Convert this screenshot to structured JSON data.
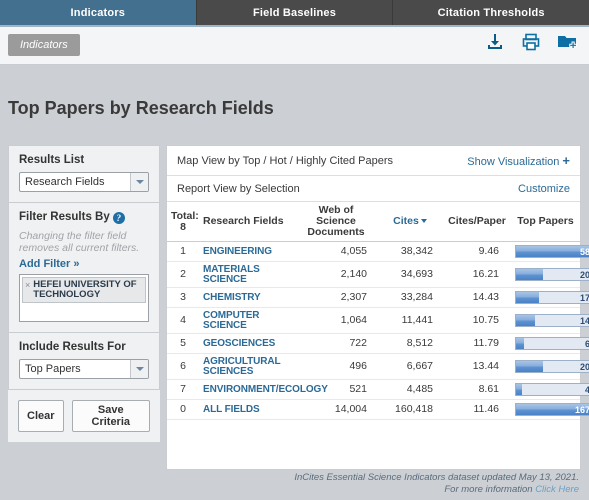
{
  "tabs": [
    {
      "label": "Indicators",
      "active": true
    },
    {
      "label": "Field Baselines",
      "active": false
    },
    {
      "label": "Citation Thresholds",
      "active": false
    }
  ],
  "toolbar": {
    "breadcrumb": "Indicators",
    "icons": [
      {
        "name": "download-icon",
        "label": "Download"
      },
      {
        "name": "print-icon",
        "label": "Print"
      },
      {
        "name": "add-to-folder-icon",
        "label": "Add to folder"
      }
    ]
  },
  "page_title": "Top Papers by Research Fields",
  "sidebar": {
    "results_list": {
      "label": "Results List",
      "value": "Research Fields"
    },
    "filter": {
      "label": "Filter Results By",
      "help_icon": "help-icon",
      "hint": "Changing the filter field removes all current filters.",
      "add_filter": "Add Filter »",
      "chips": [
        {
          "remove": "×",
          "label": "HEFEI UNIVERSITY OF TECHNOLOGY"
        }
      ]
    },
    "include": {
      "label": "Include Results For",
      "value": "Top Papers"
    },
    "buttons": {
      "clear": "Clear",
      "save": "Save Criteria"
    }
  },
  "main": {
    "map_view_label": "Map View by Top / Hot / Highly Cited Papers",
    "show_visualization": "Show Visualization",
    "report_view_label": "Report View by Selection",
    "customize": "Customize",
    "total_label": "Total:",
    "total_value": "8"
  },
  "chart_data": {
    "type": "table",
    "title": "Top Papers by Research Fields",
    "columns": [
      "Total:\n8",
      "Research Fields",
      "Web of Science Documents",
      "Cites",
      "Cites/Paper",
      "Top Papers"
    ],
    "sorted_by": "Cites",
    "sort_direction": "desc",
    "rows": [
      {
        "rank": "1",
        "field": "ENGINEERING",
        "wos": "4,055",
        "cites": "38,342",
        "cites_per_paper": "9.46",
        "top_papers": "58",
        "bar_pct": 100
      },
      {
        "rank": "2",
        "field": "MATERIALS SCIENCE",
        "wos": "2,140",
        "cites": "34,693",
        "cites_per_paper": "16.21",
        "top_papers": "20",
        "bar_pct": 35
      },
      {
        "rank": "3",
        "field": "CHEMISTRY",
        "wos": "2,307",
        "cites": "33,284",
        "cites_per_paper": "14.43",
        "top_papers": "17",
        "bar_pct": 30
      },
      {
        "rank": "4",
        "field": "COMPUTER SCIENCE",
        "wos": "1,064",
        "cites": "11,441",
        "cites_per_paper": "10.75",
        "top_papers": "14",
        "bar_pct": 25
      },
      {
        "rank": "5",
        "field": "GEOSCIENCES",
        "wos": "722",
        "cites": "8,512",
        "cites_per_paper": "11.79",
        "top_papers": "6",
        "bar_pct": 11
      },
      {
        "rank": "6",
        "field": "AGRICULTURAL SCIENCES",
        "wos": "496",
        "cites": "6,667",
        "cites_per_paper": "13.44",
        "top_papers": "20",
        "bar_pct": 35
      },
      {
        "rank": "7",
        "field": "ENVIRONMENT/ECOLOGY",
        "wos": "521",
        "cites": "4,485",
        "cites_per_paper": "8.61",
        "top_papers": "4",
        "bar_pct": 8
      },
      {
        "rank": "0",
        "field": "ALL FIELDS",
        "wos": "14,004",
        "cites": "160,418",
        "cites_per_paper": "11.46",
        "top_papers": "167",
        "bar_pct": 100
      }
    ],
    "xlabel": "",
    "ylabel": "Top Papers",
    "legend": []
  },
  "footer": {
    "line1": "InCites Essential Science Indicators dataset updated May 13, 2021.",
    "line2_prefix": "For more information ",
    "line2_link": "Click Here"
  },
  "colors": {
    "accent_blue": "#2b6a96",
    "active_tab": "#44708f",
    "bar_fill": "#4a82c8",
    "page_bg": "#ccd0d4"
  }
}
